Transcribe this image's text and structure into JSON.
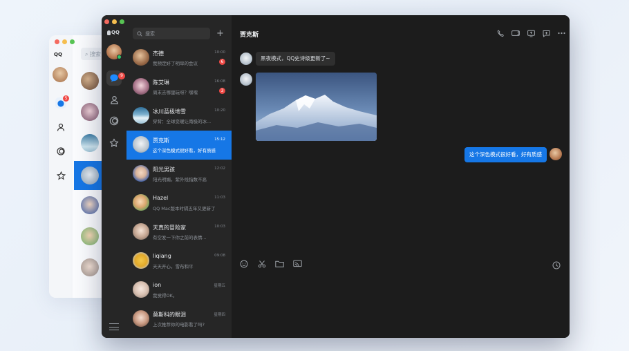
{
  "app": {
    "logo_text": "QQ"
  },
  "background_window": {
    "logo_text": "QQ",
    "search_placeholder": "搜索",
    "badge": "5"
  },
  "rail": {
    "badge": "9",
    "icons": [
      "chat-icon",
      "contacts-icon",
      "channel-icon",
      "favorites-icon",
      "menu-icon"
    ]
  },
  "search": {
    "placeholder": "搜索",
    "add_label": "+"
  },
  "conversations": [
    {
      "name": "杰德",
      "message": "我预定好了明早的会议",
      "time": "10:00",
      "unread": "6"
    },
    {
      "name": "陈艾琳",
      "message": "周末去哪里玩呀？嘿嘿",
      "time": "16:08",
      "unread": "3"
    },
    {
      "name": "冰川蓝极地雪",
      "message": "穿背：全球变暖让南极的冰...",
      "time": "10:20",
      "unread": ""
    },
    {
      "name": "贾克斯",
      "message": "这个深色模式很好看，好有质感",
      "time": "15:12",
      "unread": ""
    },
    {
      "name": "阳光男孩",
      "message": "阳光明媚，紫外线指数不高",
      "time": "12:02",
      "unread": ""
    },
    {
      "name": "Hazel",
      "message": "QQ Mac版本时隔五年又更新了",
      "time": "11:03",
      "unread": ""
    },
    {
      "name": "天真的冒险家",
      "message": "有空发一下你之前的表情...",
      "time": "10:03",
      "unread": ""
    },
    {
      "name": "liqiang",
      "message": "天天开心，雪布和平",
      "time": "09:08",
      "unread": ""
    },
    {
      "name": "ion",
      "message": "我觉得OK。",
      "time": "星期五",
      "unread": ""
    },
    {
      "name": "莫斯科的眼泪",
      "message": "上次推荐你的电影看了吗?",
      "time": "星期四",
      "unread": ""
    }
  ],
  "chat": {
    "title": "贾克斯",
    "messages": [
      {
        "from": "them",
        "text": "黑夜模式，QQ史诗级更新了~"
      },
      {
        "from": "them",
        "type": "image"
      },
      {
        "from": "me",
        "text": "这个深色模式很好看，好有质感"
      }
    ],
    "header_icons": [
      "phone-icon",
      "video-icon",
      "screen-share-icon",
      "add-chat-icon",
      "more-icon"
    ],
    "toolbar_icons": [
      "emoji-icon",
      "scissors-icon",
      "folder-icon",
      "screenshot-icon"
    ],
    "history_icon": "clock-icon"
  }
}
